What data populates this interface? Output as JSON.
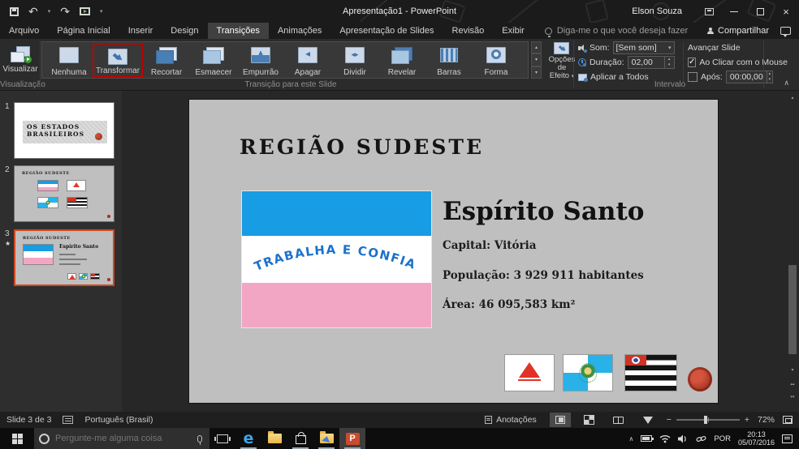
{
  "window": {
    "title": "Apresentação1 - PowerPoint",
    "user": "Elson Souza"
  },
  "icons": {
    "undo": "↶",
    "redo": "↷",
    "dropdown": "▾",
    "up": "▴",
    "down": "▾",
    "left": "◂",
    "right": "▸",
    "left_right": "◂▸",
    "check": "✓",
    "close": "×",
    "chevron_up": "∧",
    "star": "★",
    "minus": "−",
    "plus": "+",
    "edge": "e",
    "double_up": "▴▴",
    "double_down": "▾▾"
  },
  "tabs": [
    {
      "label": "Arquivo"
    },
    {
      "label": "Página Inicial"
    },
    {
      "label": "Inserir"
    },
    {
      "label": "Design"
    },
    {
      "label": "Transições"
    },
    {
      "label": "Animações"
    },
    {
      "label": "Apresentação de Slides"
    },
    {
      "label": "Revisão"
    },
    {
      "label": "Exibir"
    }
  ],
  "tellme": "Diga-me o que você deseja fazer",
  "share_label": "Compartilhar",
  "ribbon": {
    "preview_button": "Visualizar",
    "preview_group": "Visualização",
    "gallery_group": "Transição para este Slide",
    "effect_options_line1": "Opções de",
    "effect_options_line2": "Efeito",
    "transitions": [
      {
        "label": "Nenhuma"
      },
      {
        "label": "Transformar"
      },
      {
        "label": "Recortar"
      },
      {
        "label": "Esmaecer"
      },
      {
        "label": "Empurrão"
      },
      {
        "label": "Apagar"
      },
      {
        "label": "Dividir"
      },
      {
        "label": "Revelar"
      },
      {
        "label": "Barras"
      },
      {
        "label": "Forma"
      }
    ],
    "timing": {
      "group": "Intervalo",
      "sound_label": "Som:",
      "sound_value": "[Sem som]",
      "duration_label": "Duração:",
      "duration_value": "02,00",
      "apply_all": "Aplicar a Todos",
      "advance_label": "Avançar Slide",
      "on_click": "Ao Clicar com o Mouse",
      "after_label": "Após:",
      "after_value": "00:00,00"
    }
  },
  "thumbnails": [
    {
      "num": "1",
      "line1": "OS ESTADOS",
      "line2": "BRASILEIROS"
    },
    {
      "num": "2",
      "title": "REGIÃO SUDESTE"
    },
    {
      "num": "3",
      "title": "REGIÃO SUDESTE",
      "state": "Espírito Santo"
    }
  ],
  "slide": {
    "title": "REGIÃO SUDESTE",
    "state": "Espírito Santo",
    "motto": "TRABALHA  E  CONFIA",
    "capital": "Capital: Vitória",
    "population": "População: 3 929 911 habitantes",
    "area": "Área: 46 095,583 km²"
  },
  "statusbar": {
    "slide_info": "Slide 3 de 3",
    "language": "Português (Brasil)",
    "notes": "Anotações",
    "zoom_level": "72%"
  },
  "taskbar": {
    "search_placeholder": "Pergunte-me alguma coisa",
    "lang": "POR",
    "time": "20:13",
    "date": "05/07/2016"
  }
}
